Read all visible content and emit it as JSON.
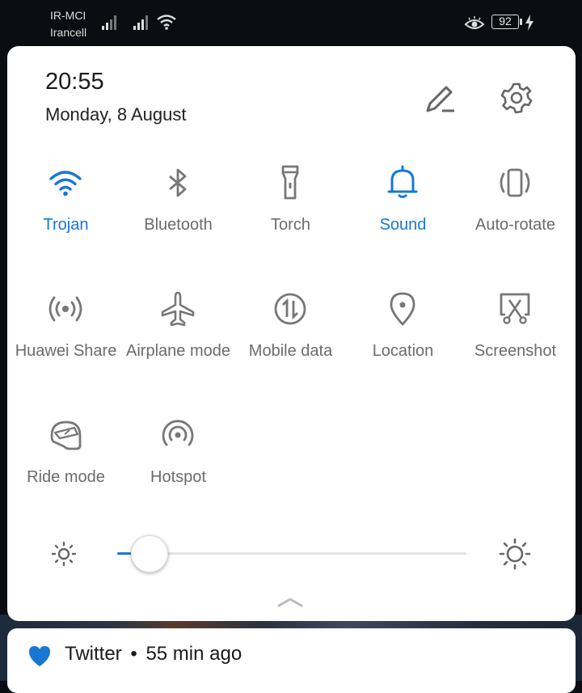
{
  "status_bar": {
    "carrier_1": "IR-MCI",
    "carrier_2": "Irancell",
    "battery_level": "92",
    "icons": [
      "signal-icon",
      "signal-icon",
      "wifi-icon",
      "eye-comfort-icon",
      "battery-icon",
      "charging-icon"
    ]
  },
  "header": {
    "time": "20:55",
    "date": "Monday, 8 August",
    "edit_icon": "pencil-icon",
    "settings_icon": "gear-icon"
  },
  "tiles": [
    {
      "label": "Trojan",
      "icon": "wifi-icon",
      "active": true
    },
    {
      "label": "Bluetooth",
      "icon": "bluetooth-icon",
      "active": false
    },
    {
      "label": "Torch",
      "icon": "torch-icon",
      "active": false
    },
    {
      "label": "Sound",
      "icon": "bell-icon",
      "active": true
    },
    {
      "label": "Auto-rotate",
      "icon": "auto-rotate-icon",
      "active": false
    },
    {
      "label": "Huawei Share",
      "icon": "huawei-share-icon",
      "active": false
    },
    {
      "label": "Airplane mode",
      "icon": "airplane-icon",
      "active": false
    },
    {
      "label": "Mobile data",
      "icon": "mobile-data-icon",
      "active": false
    },
    {
      "label": "Location",
      "icon": "location-pin-icon",
      "active": false
    },
    {
      "label": "Screenshot",
      "icon": "screenshot-icon",
      "active": false
    },
    {
      "label": "Ride mode",
      "icon": "helmet-icon",
      "active": false
    },
    {
      "label": "Hotspot",
      "icon": "hotspot-icon",
      "active": false
    }
  ],
  "brightness": {
    "level": 0.04,
    "low_icon": "sun-small-icon",
    "high_icon": "sun-large-icon"
  },
  "notification": {
    "app": "Twitter",
    "separator": "•",
    "time_ago": "55 min ago",
    "icon": "heart-icon"
  },
  "colors": {
    "accent": "#1877d2",
    "inactive": "#6b6b6b",
    "panel": "#ffffff",
    "heart": "#1877d2"
  }
}
